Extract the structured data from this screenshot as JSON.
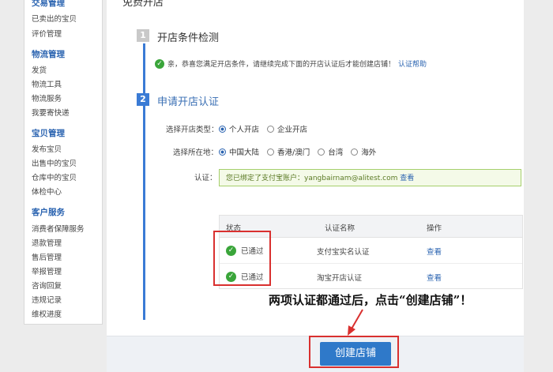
{
  "sidebar": {
    "groups": [
      {
        "title": "交易管理",
        "items": [
          "已卖出的宝贝",
          "评价管理"
        ]
      },
      {
        "title": "物流管理",
        "items": [
          "发货",
          "物流工具",
          "物流服务",
          "我要寄快递"
        ]
      },
      {
        "title": "宝贝管理",
        "items": [
          "发布宝贝",
          "出售中的宝贝",
          "仓库中的宝贝",
          "体检中心"
        ]
      },
      {
        "title": "客户服务",
        "items": [
          "消费者保障服务",
          "退款管理",
          "售后管理",
          "举报管理",
          "咨询回复",
          "违规记录",
          "维权进度"
        ]
      }
    ]
  },
  "main": {
    "tab_title": "免费开店",
    "step1": {
      "num": "1",
      "title": "开店条件检测"
    },
    "notice": {
      "text": "亲，恭喜您满足开店条件，请继续完成下面的开店认证后才能创建店铺！",
      "link": "认证帮助"
    },
    "step2": {
      "num": "2",
      "title": "申请开店认证"
    },
    "shop_type": {
      "label": "选择开店类型：",
      "options": [
        "个人开店",
        "企业开店"
      ],
      "selected": "个人开店"
    },
    "region": {
      "label": "选择所在地：",
      "options": [
        "中国大陆",
        "香港/澳门",
        "台湾",
        "海外"
      ],
      "selected": "中国大陆"
    },
    "auth": {
      "label": "认证：",
      "text": "您已绑定了支付宝账户：yangbairnam@alitest.com",
      "view": "查看"
    },
    "table": {
      "headers": [
        "状态",
        "认证名称",
        "操作"
      ],
      "rows": [
        {
          "status": "已通过",
          "name": "支付宝实名认证",
          "action": "查看"
        },
        {
          "status": "已通过",
          "name": "淘宝开店认证",
          "action": "查看"
        }
      ]
    },
    "annotation": "两项认证都通过后，点击“创建店铺”！",
    "create_button": "创建店铺"
  },
  "colors": {
    "accent": "#2f79c9",
    "success": "#3aa53a",
    "highlight": "#d9302f"
  }
}
